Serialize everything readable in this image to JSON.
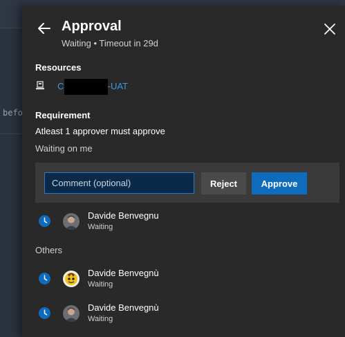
{
  "background": {
    "peek_text": "befo"
  },
  "panel": {
    "title": "Approval",
    "subtitle": "Waiting • Timeout in 29d",
    "back_icon": "arrow-left-icon",
    "close_icon": "close-icon"
  },
  "resources": {
    "heading": "Resources",
    "item_icon": "build-agent-icon",
    "item_prefix": "C",
    "item_suffix": "a-UAT"
  },
  "requirement": {
    "heading": "Requirement",
    "rule": "Atleast 1 approver must approve",
    "waiting_on": "Waiting on me"
  },
  "actions": {
    "comment_placeholder": "Comment (optional)",
    "reject_label": "Reject",
    "approve_label": "Approve"
  },
  "me": {
    "name": "Davide Benvegnu",
    "status": "Waiting"
  },
  "others": {
    "heading": "Others",
    "items": [
      {
        "name": "Davide Benvegnù",
        "status": "Waiting"
      },
      {
        "name": "Davide Benvegnù",
        "status": "Waiting"
      }
    ]
  },
  "colors": {
    "panel_bg": "#292929",
    "accent": "#0f6cbd",
    "link": "#3b9ae1",
    "status_waiting": "#0f6cbd"
  }
}
